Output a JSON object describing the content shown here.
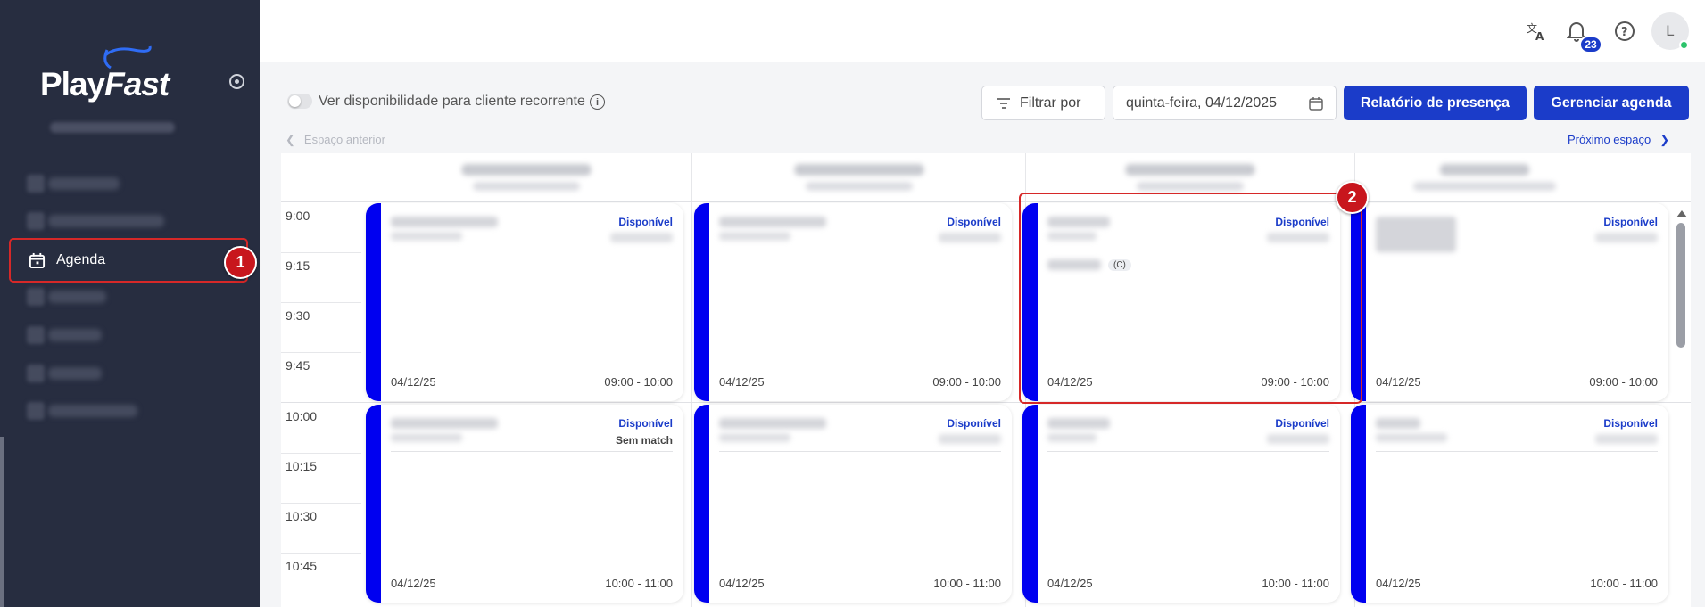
{
  "brand": {
    "play": "Play",
    "fast": "Fast"
  },
  "sidebar": {
    "active_item": {
      "label": "Agenda",
      "step": "1"
    }
  },
  "header": {
    "notifications_count": "23",
    "avatar_initial": "L"
  },
  "toolbar": {
    "toggle_label": "Ver disponibilidade para cliente recorrente",
    "filter_label": "Filtrar por",
    "date_value": "quinta-feira, 04/12/2025",
    "report_button": "Relatório de presença",
    "manage_button": "Gerenciar agenda"
  },
  "space_nav": {
    "prev": "Espaço anterior",
    "next": "Próximo espaço"
  },
  "times": [
    "9:00",
    "9:15",
    "9:30",
    "9:45",
    "10:00",
    "10:15",
    "10:30",
    "10:45"
  ],
  "highlight_step": "2",
  "cards": [
    {
      "status": "Disponível",
      "sub": "",
      "date": "04/12/25",
      "time": "09:00 - 10:00"
    },
    {
      "status": "Disponível",
      "sub": "",
      "date": "04/12/25",
      "time": "09:00 - 10:00"
    },
    {
      "status": "Disponível",
      "sub": "",
      "date": "04/12/25",
      "time": "09:00 - 10:00",
      "tag": "(C)"
    },
    {
      "status": "Disponível",
      "sub": "",
      "date": "04/12/25",
      "time": "09:00 - 10:00"
    },
    {
      "status": "Disponível",
      "sub": "Sem match",
      "date": "04/12/25",
      "time": "10:00 - 11:00"
    },
    {
      "status": "Disponível",
      "sub": "",
      "date": "04/12/25",
      "time": "10:00 - 11:00"
    },
    {
      "status": "Disponível",
      "sub": "",
      "date": "04/12/25",
      "time": "10:00 - 11:00"
    },
    {
      "status": "Disponível",
      "sub": "",
      "date": "04/12/25",
      "time": "10:00 - 11:00"
    }
  ],
  "colors": {
    "primary": "#1b3cc9",
    "sidebar_bg": "#272d40",
    "stripe": "#0000f0",
    "highlight": "#d62828"
  }
}
